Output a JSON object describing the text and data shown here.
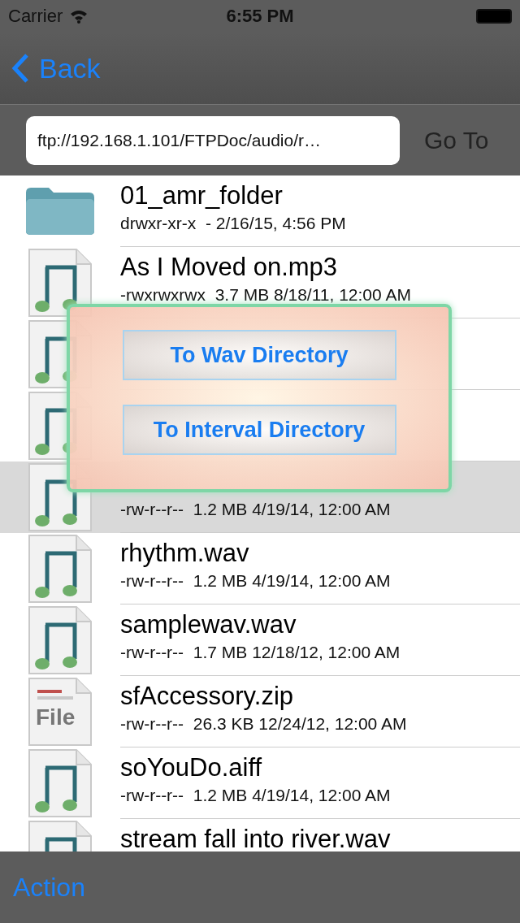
{
  "status_bar": {
    "carrier": "Carrier",
    "time": "6:55 PM"
  },
  "nav": {
    "back": "Back"
  },
  "address": {
    "value": "ftp://192.168.1.101/FTPDoc/audio/r…",
    "go": {
      "label": "Go To",
      "disabled": true
    }
  },
  "files": [
    {
      "kind": "folder",
      "name": "01_amr_folder",
      "meta": "drwxr-xr-x  - 2/16/15, 4:56 PM",
      "selected": false
    },
    {
      "kind": "music",
      "name": "As I Moved on.mp3",
      "meta": "-rwxrwxrwx  3.7 MB 8/18/11, 12:00 AM",
      "selected": false
    },
    {
      "kind": "music",
      "selected": false
    },
    {
      "kind": "music",
      "selected": false
    },
    {
      "kind": "music",
      "meta": "-rw-r--r--  1.2 MB 4/19/14, 12:00 AM",
      "selected": true
    },
    {
      "kind": "music",
      "name": "rhythm.wav",
      "meta": "-rw-r--r--  1.2 MB 4/19/14, 12:00 AM",
      "selected": false
    },
    {
      "kind": "music",
      "name": "samplewav.wav",
      "meta": "-rw-r--r--  1.7 MB 12/18/12, 12:00 AM",
      "selected": false
    },
    {
      "kind": "file",
      "name": "sfAccessory.zip",
      "meta": "-rw-r--r--  26.3 KB 12/24/12, 12:00 AM",
      "selected": false,
      "badge": "File"
    },
    {
      "kind": "music",
      "name": "soYouDo.aiff",
      "meta": "-rw-r--r--  1.2 MB 4/19/14, 12:00 AM",
      "selected": false
    },
    {
      "kind": "music",
      "name": "stream fall into river.wav",
      "selected": false
    }
  ],
  "popup": {
    "buttons": [
      "To Wav Directory",
      "To Interval Directory"
    ]
  },
  "toolbar": {
    "action": "Action"
  }
}
